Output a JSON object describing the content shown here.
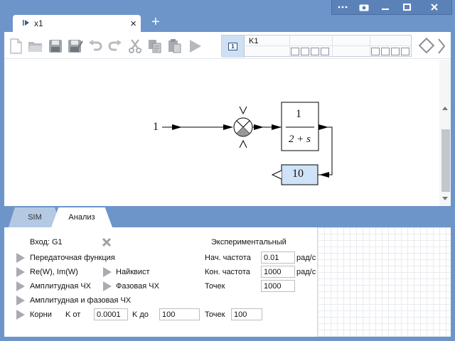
{
  "window": {
    "controls": [
      "more-icon",
      "camera-icon",
      "minimize-icon",
      "maximize-icon",
      "close-icon"
    ]
  },
  "tabs": {
    "document_tab": "x1",
    "new_tab": "+"
  },
  "toolbar": {
    "buttons": [
      "new-file-icon",
      "open-folder-icon",
      "save-icon",
      "save-as-icon",
      "undo-icon",
      "redo-icon",
      "cut-icon",
      "copy-icon",
      "paste-icon",
      "run-icon"
    ],
    "probe_index": "1",
    "probe_label": "K1"
  },
  "diagram": {
    "input_value": "1",
    "tf_numerator": "1",
    "tf_denominator": "2 + s",
    "feedback_gain": "10"
  },
  "bottom_tabs": [
    "SIM",
    "Анализ"
  ],
  "analysis": {
    "input_label": "Вход: G1",
    "experimental_label": "Экспериментальный",
    "transfer_fn": "Передаточная функция",
    "re_im": "Re(W), Im(W)",
    "nyquist": "Найквист",
    "amp_freq": "Амплитудная ЧХ",
    "phase_freq": "Фазовая ЧХ",
    "amp_phase": "Амплитудная и фазовая ЧХ",
    "roots": "Корни",
    "k_from_label": "K от",
    "k_from": "0.0001",
    "k_to_label": "K до",
    "k_to": "100",
    "roots_points_label": "Точек",
    "roots_points": "100",
    "start_freq_label": "Нач. частота",
    "start_freq": "0.01",
    "start_freq_unit": "рад/с",
    "end_freq_label": "Кон. частота",
    "end_freq": "1000",
    "end_freq_unit": "рад/с",
    "points_label": "Точек",
    "points": "1000"
  }
}
